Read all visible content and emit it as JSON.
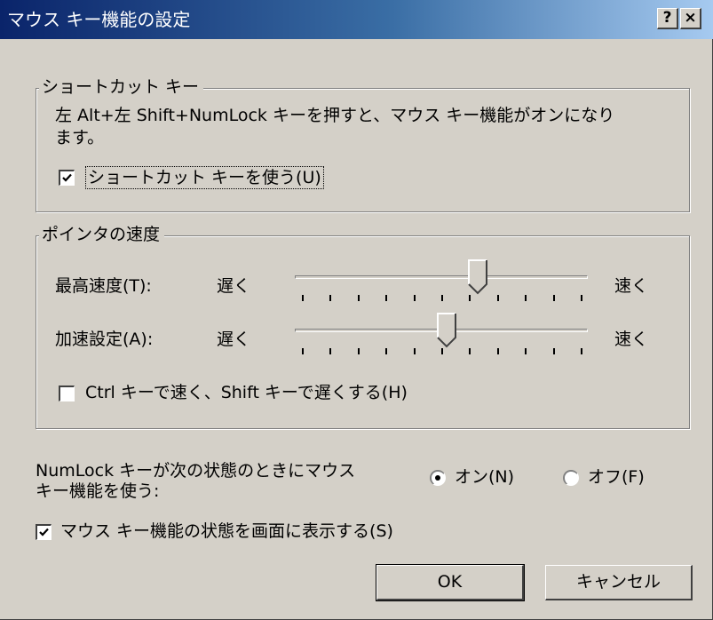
{
  "window": {
    "title": "マウス キー機能の設定",
    "help_button": "?",
    "close_button": "×"
  },
  "shortcut_group": {
    "legend": "ショートカット キー",
    "description_line1": "左 Alt+左 Shift+NumLock キーを押すと、マウス キー機能がオンになり",
    "description_line2": "ます。",
    "use_shortcut": {
      "label": "ショートカット キーを使う(U)",
      "checked": true
    }
  },
  "speed_group": {
    "legend": "ポインタの速度",
    "max_speed": {
      "label": "最高速度(T):",
      "slow": "遅く",
      "fast": "速く",
      "value": 0.63
    },
    "acceleration": {
      "label": "加速設定(A):",
      "slow": "遅く",
      "fast": "速く",
      "value": 0.52
    },
    "ctrl_shift": {
      "label": "Ctrl キーで速く、Shift キーで遅くする(H)",
      "checked": false
    }
  },
  "numlock": {
    "label_line1": "NumLock キーが次の状態のときにマウス",
    "label_line2": "キー機能を使う:",
    "on_label": "オン(N)",
    "off_label": "オフ(F)",
    "selected": "on"
  },
  "show_status": {
    "label": "マウス キー機能の状態を画面に表示する(S)",
    "checked": true
  },
  "buttons": {
    "ok": "OK",
    "cancel": "キャンセル"
  },
  "slider_ticks": 11
}
